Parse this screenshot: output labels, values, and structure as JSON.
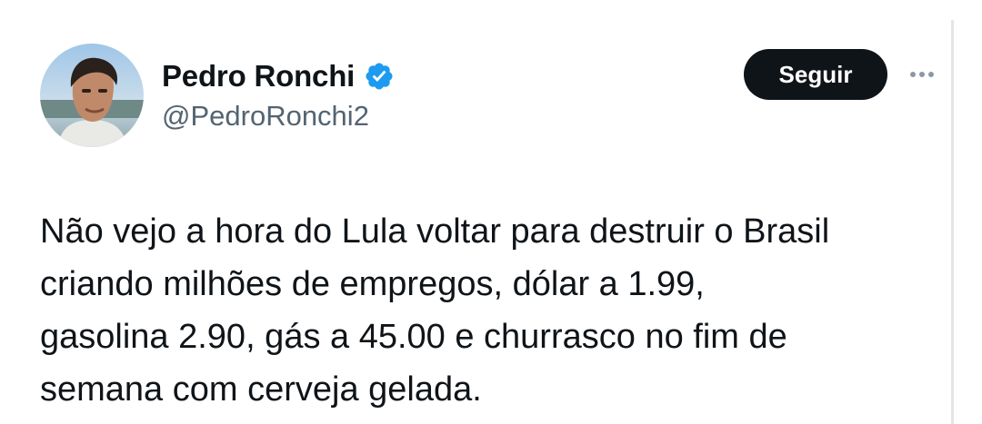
{
  "author": {
    "display_name": "Pedro Ronchi",
    "handle": "@PedroRonchi2",
    "verified": true
  },
  "actions": {
    "follow_label": "Seguir",
    "more_icon": "more-horizontal-icon"
  },
  "tweet": {
    "text": "Não vejo a hora do Lula voltar para destruir o Brasil\ncriando milhões de empregos, dólar a 1.99,\ngasolina 2.90, gás a 45.00 e churrasco no fim de\nsemana com cerveja gelada."
  },
  "colors": {
    "verified_badge": "#1d9bf0",
    "follow_button_bg": "#0f1419",
    "handle_text": "#536471",
    "body_text": "#0f1419"
  }
}
